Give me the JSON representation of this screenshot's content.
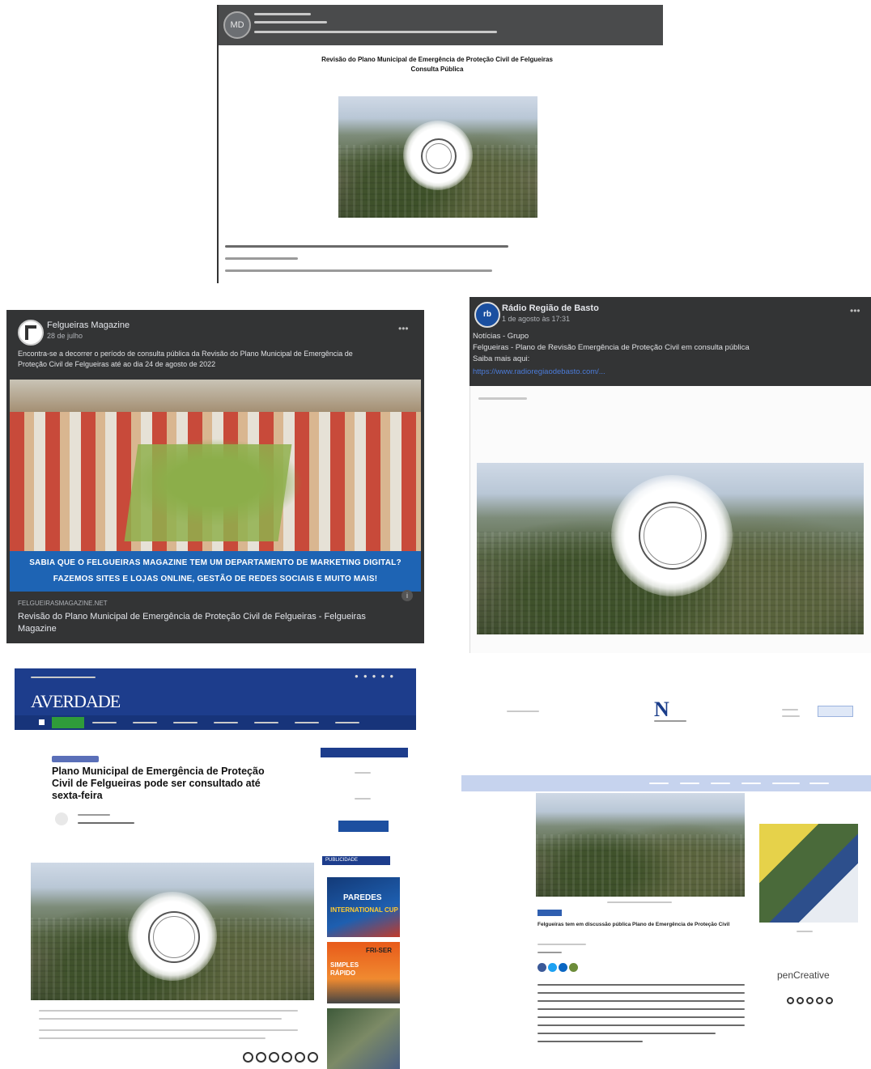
{
  "screenshots": {
    "top_post": {
      "avatar": "MD",
      "headline_line1": "Revisão do Plano Municipal de Emergência de Proteção Civil de Felgueiras",
      "headline_line2": "Consulta Pública"
    },
    "felgueiras_magazine": {
      "page_name": "Felgueiras Magazine",
      "date": "28 de julho",
      "post_text": "Encontra-se a decorrer o período de consulta pública da Revisão do Plano Municipal de Emergência de Proteção Civil de Felgueiras até ao dia 24 de agosto de 2022",
      "banner_line1": "SABIA QUE O FELGUEIRAS MAGAZINE TEM UM DEPARTAMENTO DE MARKETING DIGITAL?",
      "banner_line2": "FAZEMOS SITES E LOJAS ONLINE, GESTÃO DE REDES SOCIAIS E MUITO MAIS!",
      "link_domain": "FELGUEIRASMAGAZINE.NET",
      "link_title": "Revisão do Plano Municipal de Emergência de Proteção Civil de Felgueiras - Felgueiras Magazine"
    },
    "radio_regiao": {
      "page_name": "Rádio Região de Basto",
      "date": "1 de agosto às 17:31",
      "line1": "Notícias - Grupo",
      "line2": "Felgueiras - Plano de Revisão Emergência de Proteção Civil em consulta pública",
      "line3": "Saiba mais aqui:",
      "link": "https://www.radioregiaodebasto.com/..."
    },
    "a_verdade": {
      "logo": "AVERDADE",
      "headline": "Plano Municipal de Emergência de Proteção Civil de Felgueiras pode ser consultado até sexta-feira",
      "ad_publicidade": "PUBLICIDADE",
      "ad1_title": "PAREDES",
      "ad1_sub": "INTERNATIONAL CUP",
      "ad2_title": "FRI-SER",
      "ad2_sub": "SIMPLES RÁPIDO"
    },
    "news_n": {
      "logo": "N",
      "article_title": "Felgueiras tem em discussão pública Plano de Emergência de Proteção Civil",
      "partner": "penCreative"
    }
  }
}
